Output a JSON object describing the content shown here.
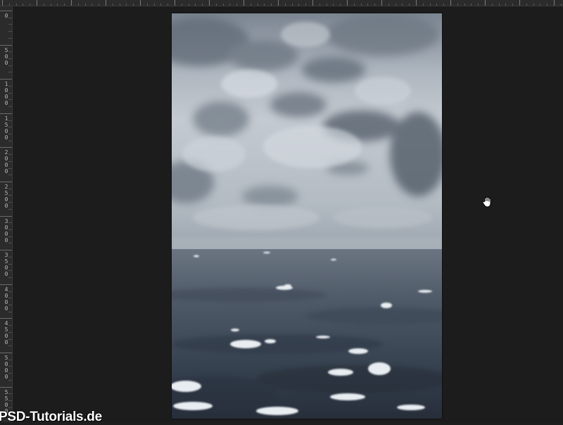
{
  "rulers": {
    "left_labels": [
      "0",
      "500",
      "1000",
      "1500",
      "2000",
      "2500",
      "3000",
      "3500",
      "4000",
      "4500",
      "5000",
      "5500"
    ]
  },
  "document": {
    "image_subject": "stormy-sea-photo"
  },
  "cursor": {
    "icon": "hand-icon"
  },
  "watermark": {
    "text": "PSD-Tutorials.de"
  },
  "colors": {
    "background": "#1c1c1c",
    "ruler": "#2b2b2b",
    "sky_top": "#6f7a86",
    "sky_light": "#c9cfd5",
    "horizon": "#a7b0b9",
    "sea_top": "#5a6573",
    "sea_bottom": "#28313d"
  }
}
